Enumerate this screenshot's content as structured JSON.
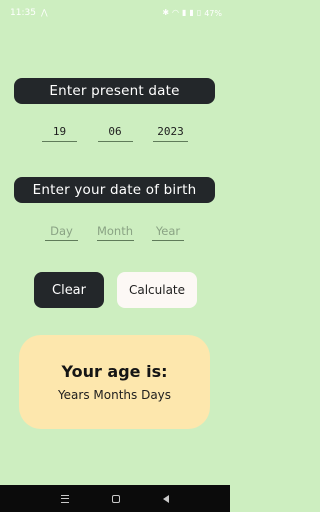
{
  "status_bar": {
    "time": "11:35",
    "battery": "47%"
  },
  "present_date": {
    "label": "Enter present date",
    "day": "19",
    "month": "06",
    "year": "2023"
  },
  "birth_date": {
    "label": "Enter your date of birth",
    "day_placeholder": "Day",
    "month_placeholder": "Month",
    "year_placeholder": "Year"
  },
  "buttons": {
    "clear_label": "Clear",
    "calculate_label": "Calculate"
  },
  "result": {
    "title": "Your age is:",
    "value": "Years Months Days"
  },
  "colors": {
    "background": "#cdeec0",
    "dark": "#23272a",
    "card": "#fde7ad"
  }
}
